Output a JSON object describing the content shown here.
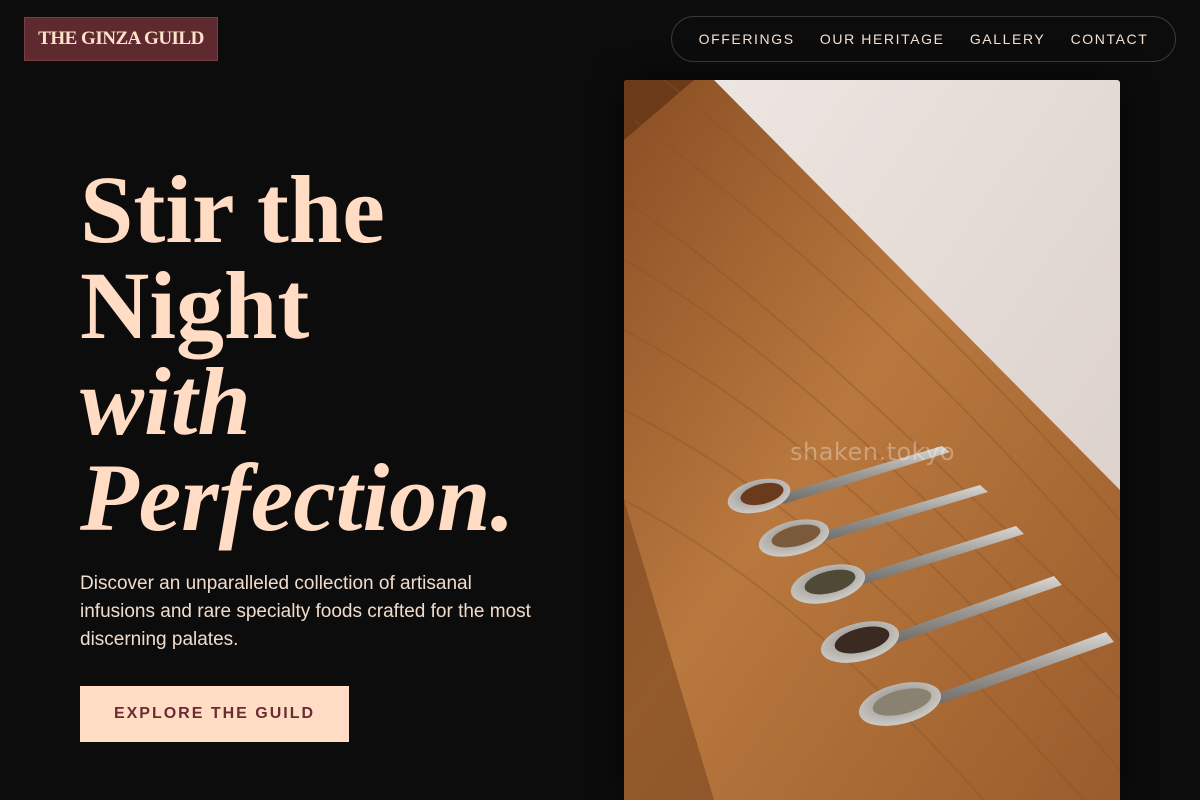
{
  "brand": {
    "logo_text": "THE GINZA GUILD"
  },
  "nav": {
    "items": [
      "OFFERINGS",
      "OUR HERITAGE",
      "GALLERY",
      "CONTACT"
    ]
  },
  "hero": {
    "line1": "Stir the",
    "line2": "Night",
    "line3": "with",
    "line4": "Perfection.",
    "description": "Discover an unparalleled collection of artisanal infusions and rare specialty foods crafted for the most discerning palates.",
    "cta_label": "EXPLORE THE GUILD"
  },
  "photo": {
    "watermark": "shaken.tokyo",
    "subject": "five silver tasting spoons with loose tea leaves on a wooden board"
  },
  "colors": {
    "background": "#0d0c0c",
    "accent_peach": "#ffdcc3",
    "logo_burgundy": "#5e2a30",
    "cta_text": "#6a2c33"
  }
}
